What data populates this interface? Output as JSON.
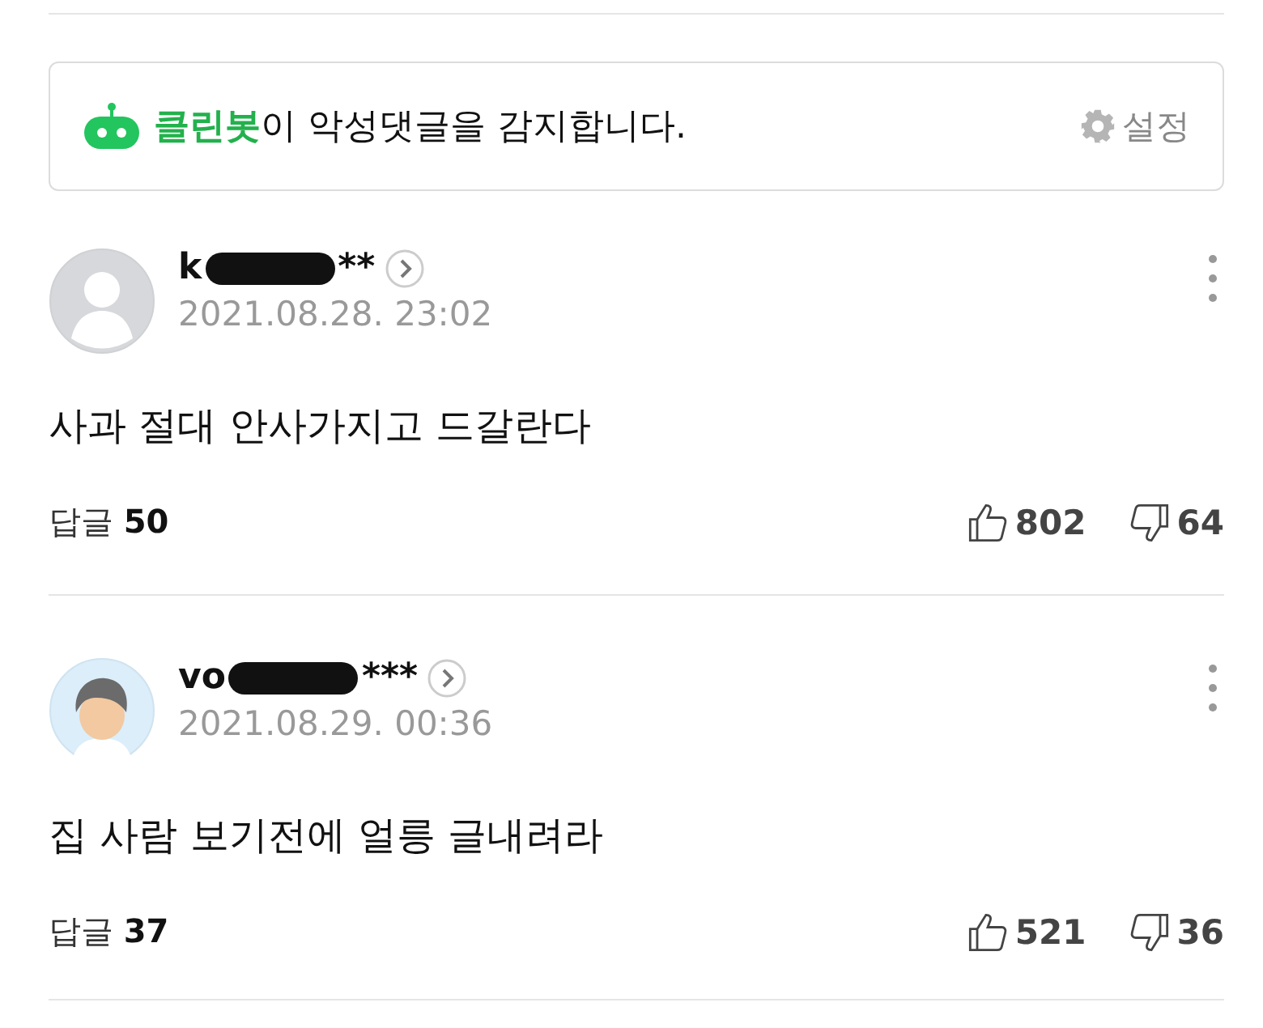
{
  "cleanbot": {
    "bot_name": "클린봇",
    "message": "이 악성댓글을 감지합니다.",
    "settings_label": "설정"
  },
  "comments": [
    {
      "avatar": {
        "kind": "default"
      },
      "name_start": "k",
      "name_end": "**",
      "date": "2021.08.28. 23:02",
      "body": "사과 절대 안사가지고 드갈란다",
      "reply_label": "답글",
      "reply_count": "50",
      "likes": "802",
      "dislikes": "64"
    },
    {
      "avatar": {
        "kind": "character"
      },
      "name_start": "vo",
      "name_end": "***",
      "date": "2021.08.29. 00:36",
      "body": "집 사람 보기전에 얼릉 글내려라",
      "reply_label": "답글",
      "reply_count": "37",
      "likes": "521",
      "dislikes": "36"
    }
  ]
}
